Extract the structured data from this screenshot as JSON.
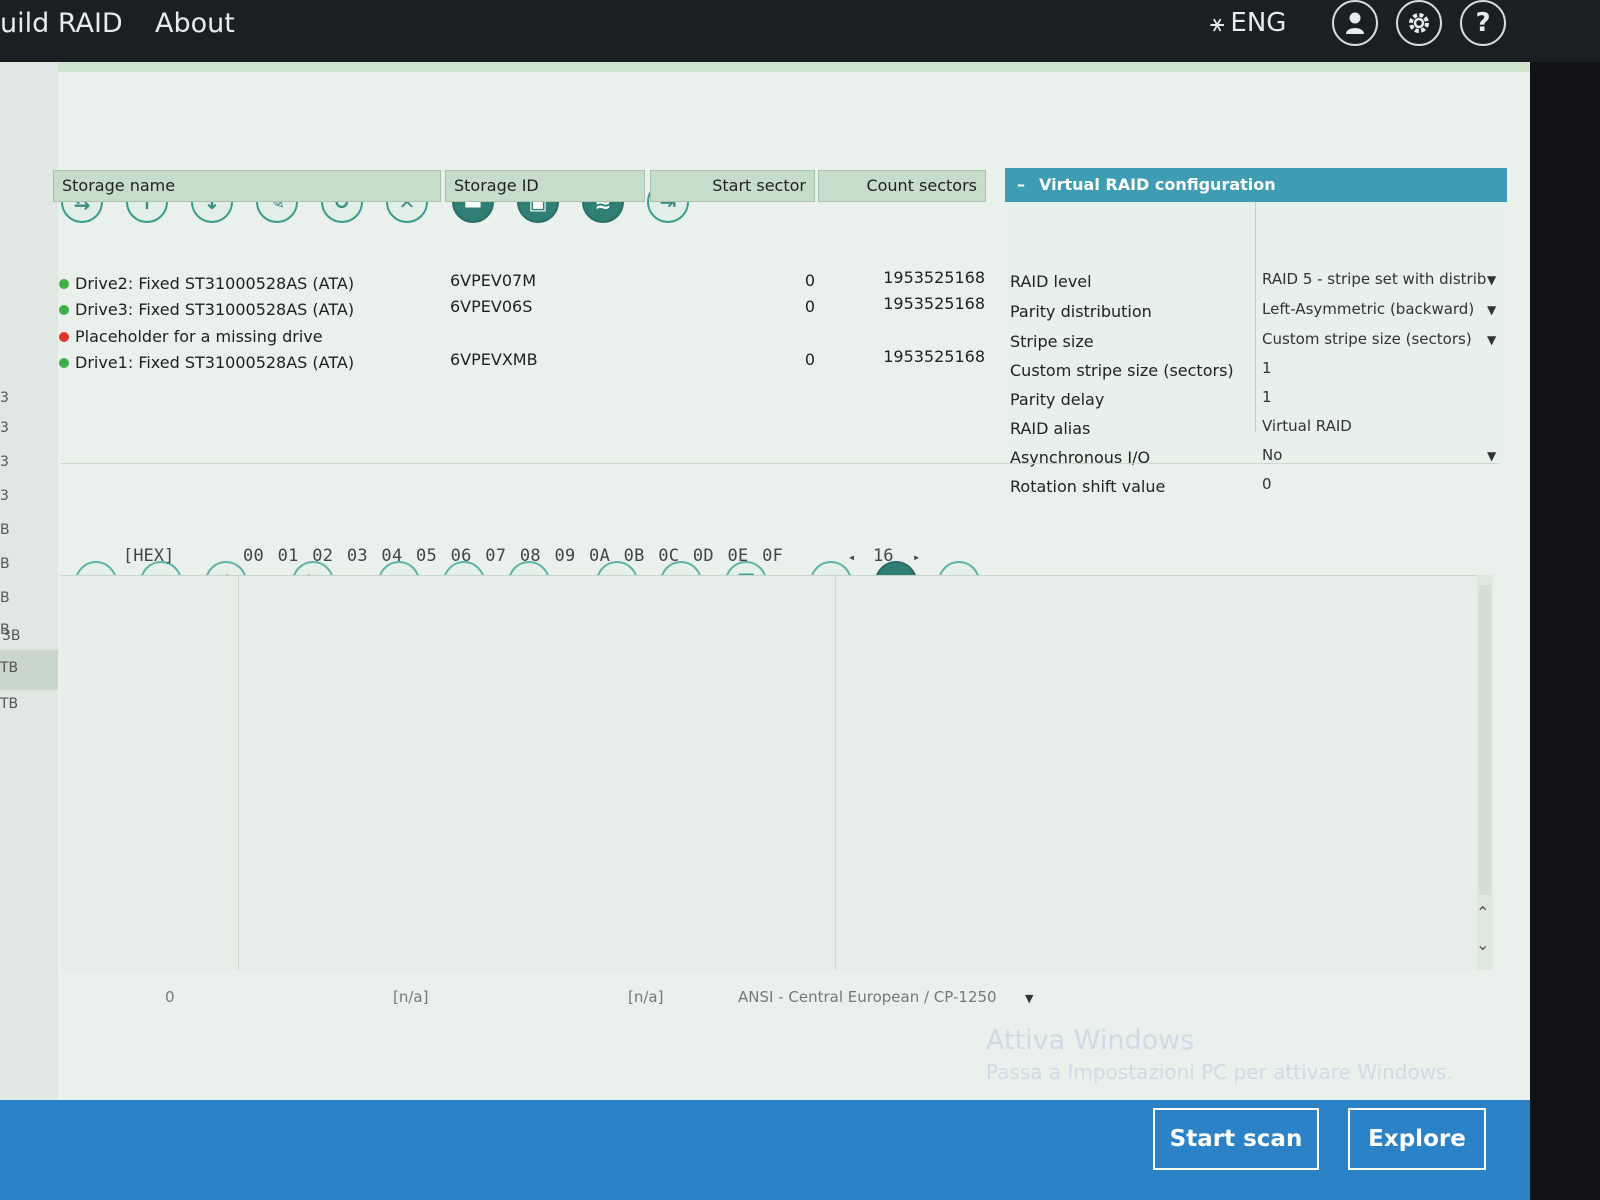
{
  "menu": {
    "build_raid": "uild RAID",
    "about": "About"
  },
  "header": {
    "lang_flag": "⚹",
    "lang": "ENG",
    "user_icon": "user-icon",
    "settings_icon": "gear-icon",
    "help_label": "?"
  },
  "sidebar": {
    "labels": [
      "3",
      "3",
      "3",
      "3",
      "B",
      "B",
      "B",
      "B",
      "3B",
      "TB",
      "TB"
    ]
  },
  "toolbar1": [
    {
      "icon": "link-drive-icon",
      "glyph": "⇆"
    },
    {
      "icon": "arrow-up-icon",
      "glyph": "↑"
    },
    {
      "icon": "arrow-down-icon",
      "glyph": "↓"
    },
    {
      "icon": "pencil-icon",
      "glyph": "✎"
    },
    {
      "icon": "undo-icon",
      "glyph": "↺"
    },
    {
      "icon": "close-icon",
      "glyph": "✕"
    },
    {
      "icon": "folder-icon",
      "glyph": "▬"
    },
    {
      "icon": "save-icon",
      "glyph": "▣"
    },
    {
      "icon": "layers-icon",
      "glyph": "≋"
    },
    {
      "icon": "export-icon",
      "glyph": "⇥"
    }
  ],
  "table": {
    "headers": {
      "name": "Storage name",
      "id": "Storage ID",
      "start": "Start sector",
      "count": "Count sectors"
    },
    "rows": [
      {
        "status": "#3fae4a",
        "name": "Drive2: Fixed ST31000528AS (ATA)",
        "id": "6VPEV07M",
        "start": "0",
        "count": "1953525168"
      },
      {
        "status": "#3fae4a",
        "name": "Drive3: Fixed ST31000528AS (ATA)",
        "id": "6VPEV06S",
        "start": "0",
        "count": "1953525168"
      },
      {
        "status": "#e0342c",
        "name": "Placeholder for a missing drive",
        "id": "",
        "start": "",
        "count": ""
      },
      {
        "status": "#3fae4a",
        "name": "Drive1: Fixed ST31000528AS (ATA)",
        "id": "6VPEVXMB",
        "start": "0",
        "count": "1953525168"
      }
    ]
  },
  "config": {
    "collapse": "–",
    "title": "Virtual RAID configuration",
    "rows": [
      {
        "label": "RAID level",
        "value": "RAID 5 - stripe set with distrib",
        "dropdown": true
      },
      {
        "label": "Parity distribution",
        "value": "Left-Asymmetric (backward)",
        "dropdown": true
      },
      {
        "label": "Stripe size",
        "value": "Custom stripe size (sectors)",
        "dropdown": true
      },
      {
        "label": "Custom stripe size (sectors)",
        "value": "1",
        "dropdown": false
      },
      {
        "label": "Parity delay",
        "value": "1",
        "dropdown": false
      },
      {
        "label": "RAID alias",
        "value": "Virtual RAID",
        "dropdown": false
      },
      {
        "label": "Asynchronous I/O",
        "value": "No",
        "dropdown": true
      },
      {
        "label": "Rotation shift value",
        "value": "0",
        "dropdown": false
      }
    ]
  },
  "toolbar2": [
    {
      "icon": "back-icon",
      "glyph": "←"
    },
    {
      "icon": "forward-icon",
      "glyph": "→"
    },
    {
      "icon": "goto-icon",
      "glyph": "↱"
    },
    {
      "icon": "bookmark-icon",
      "glyph": "⚑"
    },
    {
      "icon": "prev-block-icon",
      "glyph": "◂"
    },
    {
      "icon": "next-block-icon",
      "glyph": "▸"
    },
    {
      "icon": "list-icon",
      "glyph": "≡"
    },
    {
      "icon": "search-icon",
      "glyph": "⌕"
    },
    {
      "icon": "grid-icon",
      "glyph": "⊞"
    },
    {
      "icon": "copy-icon",
      "glyph": "❐"
    },
    {
      "icon": "refresh-icon",
      "glyph": "↻"
    },
    {
      "icon": "panel-icon",
      "glyph": "◧"
    },
    {
      "icon": "save-icon",
      "glyph": "▣"
    }
  ],
  "hex": {
    "mode": "[HEX]",
    "columns": "00 01 02 03 04 05 06 07 08 09 0A 0B 0C 0D 0E 0F",
    "width_prev": "◂",
    "width": "16",
    "width_next": "▸"
  },
  "status": {
    "offset": "0",
    "val1": "[n/a]",
    "val2": "[n/a]",
    "encoding": "ANSI - Central European / CP-1250",
    "arrow": "▼"
  },
  "watermark": {
    "line1": "Attiva Windows",
    "line2": "Passa a Impostazioni PC per attivare Windows."
  },
  "actions": {
    "start_scan": "Start scan",
    "explore": "Explore"
  }
}
